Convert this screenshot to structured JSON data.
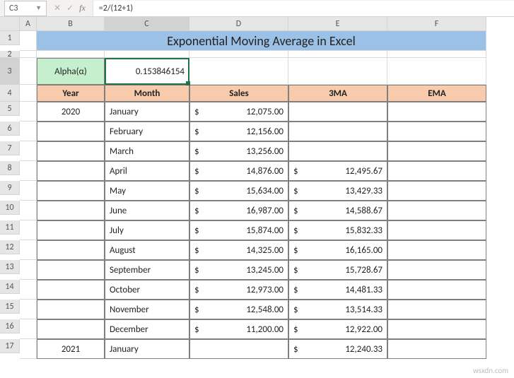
{
  "namebox": "C3",
  "formula": "=2/(12+1)",
  "title": "Exponential Moving Average in Excel",
  "alpha_label": "Alpha(α)",
  "alpha_value": "0.153846154",
  "headers": {
    "year": "Year",
    "month": "Month",
    "sales": "Sales",
    "ma3": "3MA",
    "ema": "EMA"
  },
  "cols": [
    "A",
    "B",
    "C",
    "D",
    "E",
    "F"
  ],
  "rownums": [
    "1",
    "2",
    "3",
    "4",
    "5",
    "6",
    "7",
    "8",
    "9",
    "10",
    "11",
    "12",
    "13",
    "14",
    "15",
    "16",
    "17"
  ],
  "rows": [
    {
      "year": "2020",
      "month": "January",
      "sales": "12,075.00",
      "ma3": "",
      "ema": ""
    },
    {
      "year": "",
      "month": "February",
      "sales": "12,156.00",
      "ma3": "",
      "ema": ""
    },
    {
      "year": "",
      "month": "March",
      "sales": "13,256.00",
      "ma3": "",
      "ema": ""
    },
    {
      "year": "",
      "month": "April",
      "sales": "14,876.00",
      "ma3": "12,495.67",
      "ema": ""
    },
    {
      "year": "",
      "month": "May",
      "sales": "15,634.00",
      "ma3": "13,429.33",
      "ema": ""
    },
    {
      "year": "",
      "month": "June",
      "sales": "16,987.00",
      "ma3": "14,588.67",
      "ema": ""
    },
    {
      "year": "",
      "month": "July",
      "sales": "15,874.00",
      "ma3": "15,832.33",
      "ema": ""
    },
    {
      "year": "",
      "month": "August",
      "sales": "14,325.00",
      "ma3": "16,165.00",
      "ema": ""
    },
    {
      "year": "",
      "month": "September",
      "sales": "13,245.00",
      "ma3": "15,728.67",
      "ema": ""
    },
    {
      "year": "",
      "month": "October",
      "sales": "12,973.00",
      "ma3": "14,481.33",
      "ema": ""
    },
    {
      "year": "",
      "month": "November",
      "sales": "12,548.00",
      "ma3": "13,514.33",
      "ema": ""
    },
    {
      "year": "",
      "month": "December",
      "sales": "11,200.00",
      "ma3": "12,922.00",
      "ema": ""
    },
    {
      "year": "2021",
      "month": "January",
      "sales": "",
      "ma3": "12,240.33",
      "ema": ""
    }
  ],
  "currency": "$",
  "watermark": "wsxdn.com",
  "chart_data": {
    "type": "table",
    "title": "Exponential Moving Average in Excel",
    "columns": [
      "Year",
      "Month",
      "Sales",
      "3MA",
      "EMA"
    ],
    "alpha": 0.153846154,
    "data": [
      {
        "Year": 2020,
        "Month": "January",
        "Sales": 12075.0,
        "3MA": null,
        "EMA": null
      },
      {
        "Year": 2020,
        "Month": "February",
        "Sales": 12156.0,
        "3MA": null,
        "EMA": null
      },
      {
        "Year": 2020,
        "Month": "March",
        "Sales": 13256.0,
        "3MA": null,
        "EMA": null
      },
      {
        "Year": 2020,
        "Month": "April",
        "Sales": 14876.0,
        "3MA": 12495.67,
        "EMA": null
      },
      {
        "Year": 2020,
        "Month": "May",
        "Sales": 15634.0,
        "3MA": 13429.33,
        "EMA": null
      },
      {
        "Year": 2020,
        "Month": "June",
        "Sales": 16987.0,
        "3MA": 14588.67,
        "EMA": null
      },
      {
        "Year": 2020,
        "Month": "July",
        "Sales": 15874.0,
        "3MA": 15832.33,
        "EMA": null
      },
      {
        "Year": 2020,
        "Month": "August",
        "Sales": 14325.0,
        "3MA": 16165.0,
        "EMA": null
      },
      {
        "Year": 2020,
        "Month": "September",
        "Sales": 13245.0,
        "3MA": 15728.67,
        "EMA": null
      },
      {
        "Year": 2020,
        "Month": "October",
        "Sales": 12973.0,
        "3MA": 14481.33,
        "EMA": null
      },
      {
        "Year": 2020,
        "Month": "November",
        "Sales": 12548.0,
        "3MA": 13514.33,
        "EMA": null
      },
      {
        "Year": 2020,
        "Month": "December",
        "Sales": 11200.0,
        "3MA": 12922.0,
        "EMA": null
      },
      {
        "Year": 2021,
        "Month": "January",
        "Sales": null,
        "3MA": 12240.33,
        "EMA": null
      }
    ]
  }
}
